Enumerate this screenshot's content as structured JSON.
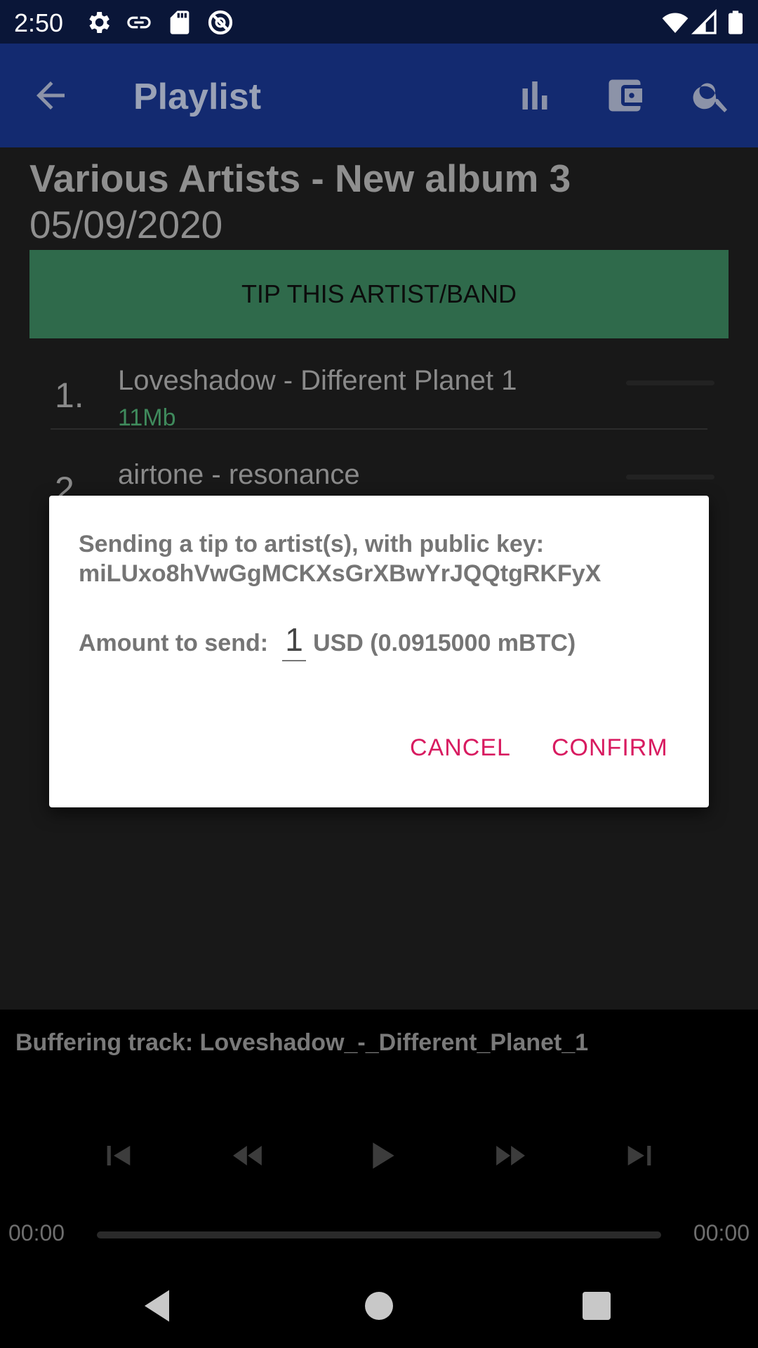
{
  "status_bar": {
    "time": "2:50",
    "icons": [
      "settings-icon",
      "link-icon",
      "sd-card-icon",
      "no-tracking-icon",
      "wifi-icon",
      "signal-icon",
      "battery-icon"
    ]
  },
  "app_bar": {
    "title": "Playlist",
    "icons": [
      "back-arrow-icon",
      "equalizer-icon",
      "wallet-icon",
      "search-icon"
    ],
    "color": "#132a70"
  },
  "album": {
    "title": "Various Artists - New album 3",
    "date": "05/09/2020",
    "tip_button_label": "TIP THIS ARTIST/BAND"
  },
  "tracks": [
    {
      "number": "1.",
      "title": "Loveshadow - Different Planet 1",
      "size": "11Mb"
    },
    {
      "number": "2.",
      "title": "airtone - resonance",
      "size": ""
    }
  ],
  "dialog": {
    "message": "Sending a tip to artist(s), with public key: miLUxo8hVwGgMCKXsGrXBwYrJQQtgRKFyX",
    "amount_label": "Amount to send:",
    "amount_value": "1",
    "amount_currency": "USD (0.0915000 mBTC)",
    "cancel_label": "CANCEL",
    "confirm_label": "CONFIRM",
    "accent_color": "#d81b60"
  },
  "player": {
    "status": "Buffering track: Loveshadow_-_Different_Planet_1",
    "elapsed": "00:00",
    "duration": "00:00",
    "progress": 0,
    "controls": [
      "skip-previous-icon",
      "rewind-icon",
      "play-icon",
      "fast-forward-icon",
      "skip-next-icon"
    ]
  },
  "nav_bar": {
    "buttons": [
      "nav-back-icon",
      "nav-home-icon",
      "nav-recents-icon"
    ]
  }
}
